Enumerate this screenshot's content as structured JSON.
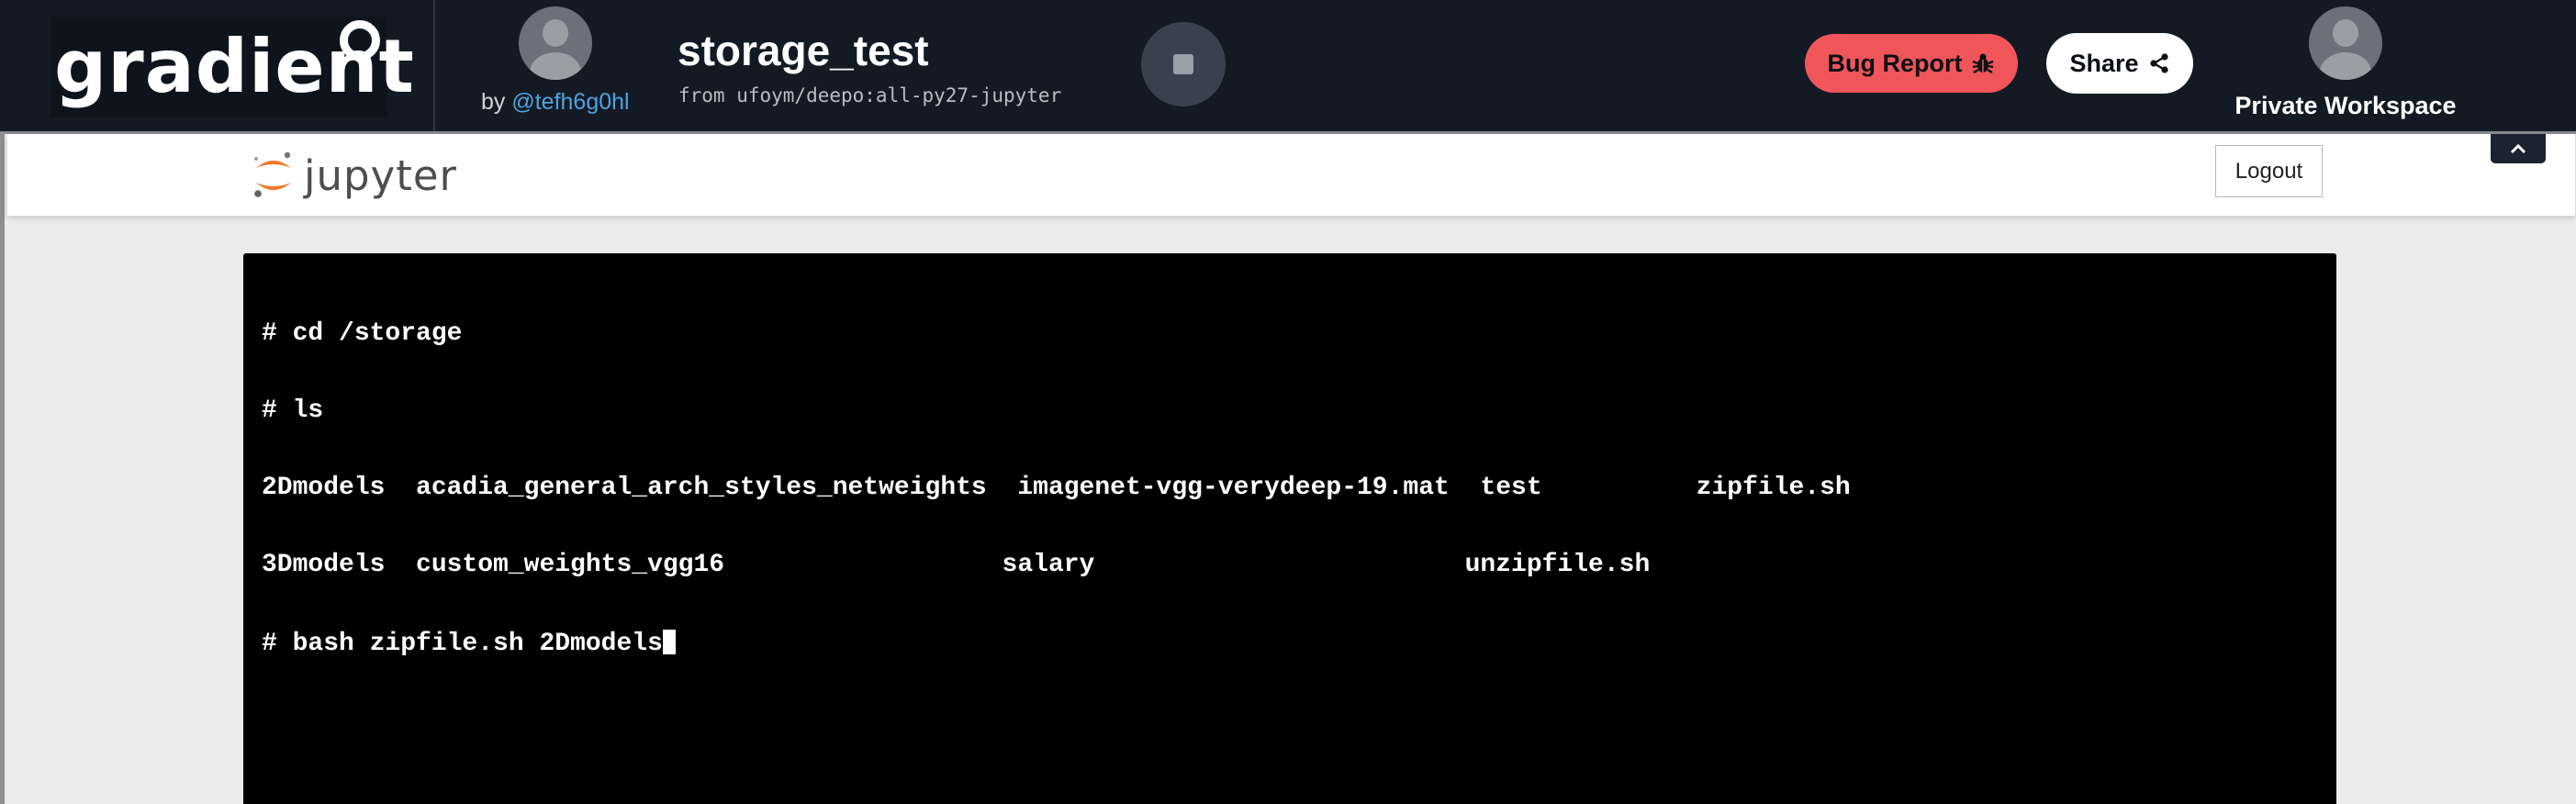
{
  "topbar": {
    "logo_text": "gradient",
    "owner": {
      "by_label": "by",
      "username": "@tefh6g0hl"
    },
    "notebook": {
      "title": "storage_test",
      "container": "from ufoym/deepo:all-py27-jupyter"
    },
    "bug_report_label": "Bug Report",
    "share_label": "Share",
    "workspace_label": "Private Workspace"
  },
  "jupyter": {
    "logo_text": "jupyter",
    "logout_label": "Logout"
  },
  "terminal": {
    "lines": [
      "# cd /storage",
      "# ls",
      "2Dmodels  acadia_general_arch_styles_netweights  imagenet-vgg-verydeep-19.mat  test          zipfile.sh",
      "3Dmodels  custom_weights_vgg16                  salary                        unzipfile.sh"
    ],
    "current_command": "# bash zipfile.sh 2Dmodels"
  },
  "colors": {
    "topbar_bg": "#141a24",
    "bug_button_bg": "#f0555a",
    "username_link": "#4fa3e0",
    "jupyter_orange": "#f37726",
    "terminal_bg": "#000000"
  },
  "icons": {
    "bug": "bug-icon",
    "share": "share-icon",
    "stop": "stop-icon",
    "collapse": "chevron-up-icon"
  }
}
